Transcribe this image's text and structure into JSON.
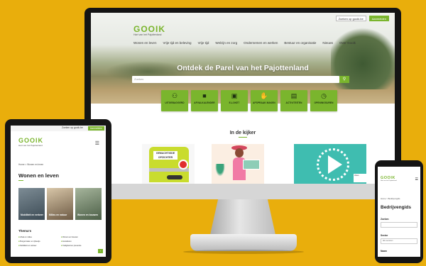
{
  "desktop": {
    "topbar": {
      "search_label": "Zoeken op gooik.be",
      "login_label": "Aanmelden"
    },
    "logo": {
      "name": "GOOIK",
      "tagline": "Hart van het Pajottenland"
    },
    "nav": [
      "Wonen en leven",
      "Vrije tijd en beleving",
      "Vrije tijd",
      "Welzijn en zorg",
      "Ondernemen en werken",
      "Bestuur en organisatie",
      "Nieuws",
      "Over Gooik"
    ],
    "hero_title": "Ontdek de Parel van het Pajottenland",
    "search_placeholder": "Zoeken",
    "categories": [
      {
        "icon": "person-icon",
        "glyph": "⚇",
        "label": "UITGEBAGGERD"
      },
      {
        "icon": "bag-icon",
        "glyph": "■",
        "label": "AFVALKALENDER"
      },
      {
        "icon": "briefcase-icon",
        "glyph": "▣",
        "label": "E-LOKET"
      },
      {
        "icon": "hand-icon",
        "glyph": "✋",
        "label": "AFSPRAAK MAKEN"
      },
      {
        "icon": "calendar-icon",
        "glyph": "▤",
        "label": "ACTIVITEITEN"
      },
      {
        "icon": "clock-icon",
        "glyph": "◷",
        "label": "OPENINGSUREN"
      }
    ],
    "section_title": "In de kijker",
    "card1_label": "GEMACHTIGDE OPZICHTER",
    "card3_chip": "Video"
  },
  "tablet": {
    "topbar": {
      "search_label": "Zoeken op gooik.be",
      "login_label": "Aanmelden"
    },
    "logo": {
      "name": "GOOIK",
      "tagline": "Hart van het Pajottenland"
    },
    "crumb": "Home > Wonen en leven",
    "title": "Wonen en leven",
    "tiles": [
      "Mobiliteit en verkeer",
      "Milieu en natuur",
      "Wonen en bouwen"
    ],
    "themes_title": "Thema's",
    "themes": [
      "Afval en milieu",
      "Wonen en bouwen",
      "Burgerzaken en rijbewijs",
      "Huisdieren",
      "Mobiliteit en verkeer",
      "Veiligheid en preventie"
    ]
  },
  "phone": {
    "logo": {
      "name": "GOOIK",
      "tagline": "Hart van het Pajottenland"
    },
    "crumb": "Home > Bedrijvengids",
    "title": "Bedrijvengids",
    "label_search": "Zoeken",
    "label_sector": "Sector",
    "sector_value": "Alle sectoren",
    "label_name": "Naam"
  },
  "colors": {
    "background": "#e9ae0c",
    "brand_green": "#7ab52d"
  }
}
